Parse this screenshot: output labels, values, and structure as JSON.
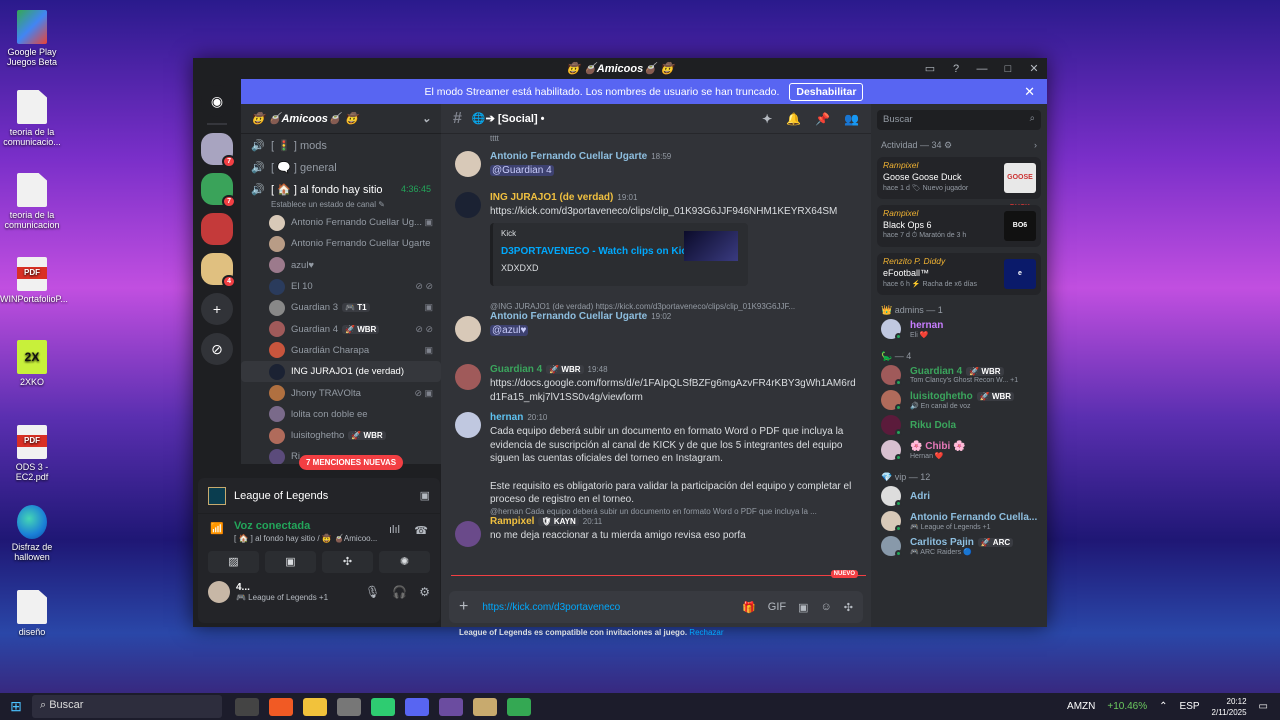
{
  "desktop": {
    "icons": [
      {
        "label": "Google Play Juegos Beta",
        "kind": "gp"
      },
      {
        "label": "teoria de la comunicacio...",
        "kind": "doc"
      },
      {
        "label": "teoria de la comunicacion",
        "kind": "doc"
      },
      {
        "label": "WINPortafolioP...",
        "kind": "pdf"
      },
      {
        "label": "2XKO",
        "kind": "x2"
      },
      {
        "label": "ODS 3 - EC2.pdf",
        "kind": "pdf"
      },
      {
        "label": "Disfraz de hallowen",
        "kind": "edge"
      },
      {
        "label": "diseño",
        "kind": "doc"
      }
    ]
  },
  "window": {
    "title": "🤠 🧉Amicoos🧉 🤠",
    "buttons": [
      "▭",
      "?",
      "—",
      "□",
      "✕"
    ]
  },
  "banner": {
    "text": "El modo Streamer está habilitado. Los nombres de usuario se han truncado.",
    "button": "Deshabilitar",
    "close": "✕"
  },
  "rail": {
    "badges": [
      "7",
      "7",
      "",
      "4"
    ]
  },
  "server": {
    "name": "🤠 🧉Amicoos🧉 🤠",
    "chevron": "⌄"
  },
  "channels": [
    {
      "prefix": "🔊",
      "name": "[ 🚦 ] mods"
    },
    {
      "prefix": "🔊",
      "name": "[ 🗨️ ] general"
    },
    {
      "prefix": "🔊",
      "name": "[ 🏠 ] al fondo hay sitio",
      "time": "4:36:45"
    }
  ],
  "channel_status": "Establece un estado de canal ✎",
  "voice_users": [
    {
      "name": "Antonio Fernando Cuellar Ug...",
      "icons": "▣",
      "color": "#d8c9b8"
    },
    {
      "name": "Antonio Fernando Cuellar Ugarte",
      "icons": "",
      "color": "#b89c86"
    },
    {
      "name": "azul♥",
      "icons": "",
      "color": "#9c7a8c"
    },
    {
      "name": "El 10",
      "icons": "⊘ ⊘",
      "color": "#2a3b5c"
    },
    {
      "name": "Guardian 3",
      "tag": "🎮 T1",
      "icons": "▣",
      "color": "#888"
    },
    {
      "name": "Guardian 4",
      "tag": "🚀 WBR",
      "icons": "⊘ ⊘",
      "color": "#a05a5a"
    },
    {
      "name": "Guardián Charapa",
      "icons": "▣",
      "color": "#c8553d"
    },
    {
      "name": "ING JURAJO1 (de verdad)",
      "icons": "",
      "color": "#1b2233",
      "hl": true
    },
    {
      "name": "Jhony TRAVOlta",
      "icons": "⊘ ▣",
      "color": "#b07040"
    },
    {
      "name": "lolita con doble ee",
      "icons": "",
      "color": "#7a6a8a"
    },
    {
      "name": "luisitoghetho",
      "tag": "🚀 WBR",
      "icons": "",
      "color": "#b06b5b"
    },
    {
      "name": "Ri...",
      "icons": "",
      "color": "#5b4b7b"
    }
  ],
  "mentions_pill": "7 MENCIONES NUEVAS",
  "voice_panel": {
    "game": "League of Legends",
    "status": "Voz conectada",
    "sub": "[ 🏠 ] al fondo hay sitio / 🤠 🧉Amicoo...",
    "buttons": [
      "▨",
      "▣",
      "✣",
      "✺"
    ]
  },
  "user_panel": {
    "name": "4...",
    "status": "🎮 League of Legends +1",
    "controls": [
      "🎙",
      "🎧",
      "⚙"
    ]
  },
  "chat": {
    "channel": "🌐➔ [Social] •",
    "header_icons": [
      "✦",
      "🔔",
      "📌",
      "👥"
    ],
    "top_fragment": "tttt",
    "messages": [
      {
        "author": "Antonio Fernando Cuellar Ugarte",
        "color": "#8ebfe0",
        "time": "18:59",
        "text": "@Guardian 4",
        "mention": true,
        "av": "#d8c9b8"
      },
      {
        "author": "ING JURAJO1 (de verdad)",
        "color": "#f0c040",
        "time": "19:01",
        "link": "https://kick.com/d3portaveneco/clips/clip_01K93G6JJF946NHM1KEYRX64SM",
        "embed": {
          "provider": "Kick",
          "title": "D3PORTAVENECO - Watch clips on Kick",
          "desc": "XDXDXD"
        },
        "av": "#1b2233"
      },
      {
        "reply": "@ING JURAJO1 (de verdad) https://kick.com/d3portaveneco/clips/clip_01K93G6JJF...",
        "author": "Antonio Fernando Cuellar Ugarte",
        "color": "#8ebfe0",
        "time": "19:02",
        "text": "@azul♥",
        "mention": true,
        "av": "#d8c9b8"
      },
      {
        "author": "Guardian 4",
        "tag": "🚀 WBR",
        "color": "#3ba55d",
        "time": "19:48",
        "link": "https://docs.google.com/forms/d/e/1FAIpQLSfBZFg6mgAzvFR4rKBY3gWh1AM6rdd1Fa15_mkj7lV1SS0v4g/viewform",
        "av": "#a05a5a"
      },
      {
        "author": "hernan",
        "color": "#5ec2f0",
        "time": "20:10",
        "text": "Cada equipo deberá subir un documento en formato Word o PDF que incluya la evidencia de suscripción al canal de KICK y de que los 5 integrantes del equipo siguen las cuentas oficiales del torneo en Instagram.",
        "text2": "Este requisito es obligatorio para validar la participación del equipo y completar el proceso de registro en el torneo.",
        "av": "#c0c8e0"
      },
      {
        "reply": "@hernan Cada equipo deberá subir un documento en formato Word o PDF que incluya la ...",
        "author": "Rampixel",
        "tag": "🛡 KAYN",
        "color": "#f0c040",
        "time": "20:11",
        "text": "no me deja reaccionar a tu mierda amigo revisa eso porfa",
        "av": "#6a4a8a"
      }
    ],
    "new_label": "NUEVO",
    "invite_note": "League of Legends es compatible con invitaciones al juego.",
    "invite_action": "Rechazar",
    "composer_value": "https://kick.com/d3portaveneco",
    "composer_icons": [
      "🎁",
      "GIF",
      "▣",
      "☺",
      "✣"
    ]
  },
  "members": {
    "search_placeholder": "Buscar",
    "activity_header": "Actividad — 34 ⚙",
    "activities": [
      {
        "who": "Rampixel",
        "game": "Goose Goose Duck",
        "meta": "hace 1 d  🏷 Nuevo jugador",
        "logo": "#e8e8e8",
        "logotext": "GOOSE DUCK"
      },
      {
        "who": "Rampixel",
        "game": "Black Ops 6",
        "meta": "hace 7 d  ⏱ Maratón de 3 h",
        "logo": "#111",
        "logotext": "BO6"
      },
      {
        "who": "Renzito P. Diddy",
        "game": "eFootball™",
        "meta": "hace 6 h  ⚡ Racha de x6 días",
        "logo": "#0a1a6a",
        "logotext": "e"
      }
    ],
    "groups": [
      {
        "header": "👑 admins — 1",
        "items": [
          {
            "name": "hernan",
            "color": "#c77dff",
            "sub": "Eli ❤️",
            "av": "#c0c8e0"
          }
        ]
      },
      {
        "header": "🦕 — 4",
        "items": [
          {
            "name": "Guardian 4",
            "tag": "🚀 WBR",
            "color": "#3ba55d",
            "sub": "Tom Clancy's Ghost Recon W... +1",
            "av": "#a05a5a"
          },
          {
            "name": "luisitoghetho",
            "tag": "🚀 WBR",
            "color": "#3ba55d",
            "sub": "🔊 En canal de voz",
            "av": "#b06b5b"
          },
          {
            "name": "Riku Dola",
            "color": "#3ba55d",
            "sub": "",
            "av": "#5b1b3b"
          },
          {
            "name": "🌸 Chibi 🌸",
            "color": "#e879b9",
            "sub": "Hernan ❤️",
            "av": "#d8c0d0"
          }
        ]
      },
      {
        "header": "💎 vip — 12",
        "items": [
          {
            "name": "Adri",
            "color": "#8ebfe0",
            "sub": "",
            "av": "#ddd"
          },
          {
            "name": "Antonio Fernando Cuella...",
            "color": "#8ebfe0",
            "sub": "🎮 League of Legends +1",
            "av": "#d8c9b8"
          },
          {
            "name": "Carlitos Pajin",
            "tag": "🚀 ARC",
            "color": "#8ebfe0",
            "sub": "🎮 ARC Raiders 🔵",
            "av": "#8899aa"
          }
        ]
      }
    ]
  },
  "taskbar": {
    "search": "Buscar",
    "stock": "AMZN",
    "change": "+10.46%",
    "lang": "ESP",
    "time": "20:12",
    "date": "2/11/2025"
  }
}
